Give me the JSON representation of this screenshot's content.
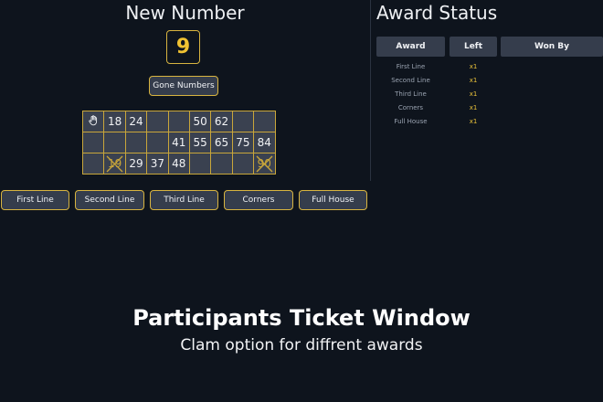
{
  "new_number": {
    "title": "New Number",
    "value": "9",
    "gone_label": "Gone Numbers"
  },
  "ticket": {
    "rows": [
      [
        {
          "v": "hand",
          "icon": true
        },
        {
          "v": "18"
        },
        {
          "v": "24"
        },
        {
          "v": ""
        },
        {
          "v": ""
        },
        {
          "v": "50"
        },
        {
          "v": "62"
        },
        {
          "v": ""
        },
        {
          "v": ""
        }
      ],
      [
        {
          "v": ""
        },
        {
          "v": ""
        },
        {
          "v": ""
        },
        {
          "v": ""
        },
        {
          "v": "41"
        },
        {
          "v": "55"
        },
        {
          "v": "65"
        },
        {
          "v": "75"
        },
        {
          "v": "84"
        }
      ],
      [
        {
          "v": ""
        },
        {
          "v": "19",
          "struck": true
        },
        {
          "v": "29"
        },
        {
          "v": "37"
        },
        {
          "v": "48"
        },
        {
          "v": ""
        },
        {
          "v": ""
        },
        {
          "v": ""
        },
        {
          "v": "90",
          "struck": true
        }
      ]
    ]
  },
  "award_buttons": [
    "First Line",
    "Second Line",
    "Third Line",
    "Corners",
    "Full House"
  ],
  "award_status": {
    "title": "Award Status",
    "headers": {
      "award": "Award",
      "left": "Left",
      "won_by": "Won By"
    },
    "rows": [
      {
        "award": "First Line",
        "left": "x1",
        "won_by": ""
      },
      {
        "award": "Second Line",
        "left": "x1",
        "won_by": ""
      },
      {
        "award": "Third Line",
        "left": "x1",
        "won_by": ""
      },
      {
        "award": "Corners",
        "left": "x1",
        "won_by": ""
      },
      {
        "award": "Full House",
        "left": "x1",
        "won_by": ""
      }
    ]
  },
  "caption": {
    "title": "Participants Ticket Window",
    "subtitle": "Clam option for diffrent awards"
  },
  "colors": {
    "accent": "#d8b440",
    "number": "#f0c232",
    "cell_bg": "#3a4150",
    "button_bg": "#353d4c",
    "background": "#0e141d"
  }
}
